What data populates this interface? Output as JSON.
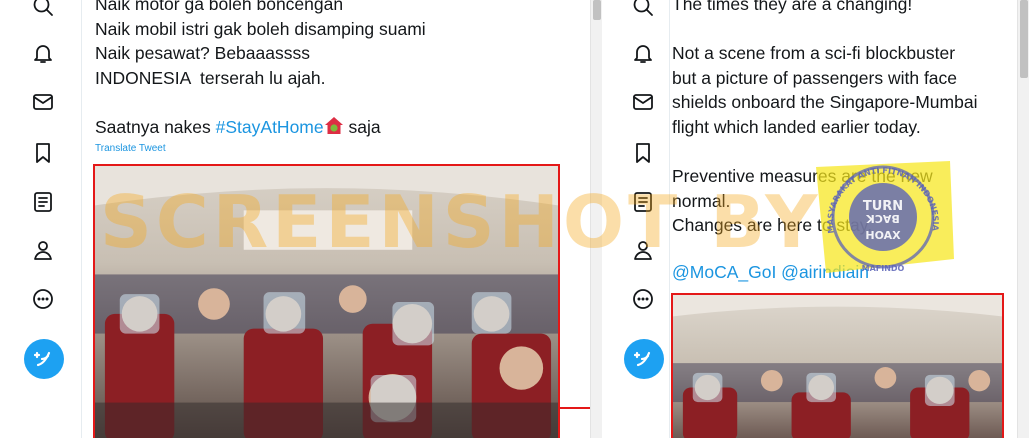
{
  "left_tweet": {
    "lines": [
      "Naik motor ga boleh boncengan",
      "Naik mobil istri gak boleh disamping suami",
      "Naik pesawat? Bebaaassss",
      "INDONESIA  terserah lu ajah.",
      "",
      "Saatnya nakes "
    ],
    "hashtag": "#StayAtHome",
    "after_hashtag": " saja",
    "translate_label": "Translate Tweet"
  },
  "right_tweet": {
    "lines": [
      "The times they are a changing!",
      "",
      "Not a scene from a sci-fi blockbuster",
      "but a picture of passengers with face",
      "shields onboard the Singapore-Mumbai",
      "flight which landed earlier today.",
      "",
      "Preventive measures are the new",
      "normal.",
      "Changes are here to stay."
    ],
    "mentions": "@MoCA_GoI @airindiain"
  },
  "overlay": {
    "watermark_text": "SCREENSHOT BY",
    "badge_top": "TURN",
    "badge_middle": "BACK",
    "badge_bottom": "HOAX",
    "badge_ring_left": "MASYARAKAT ANTI FITNAH INDONESIA",
    "badge_ring_bottom": "MAFINDO"
  },
  "colors": {
    "link": "#1b95e0",
    "compose": "#1da1f2",
    "highlight_box": "#e41818",
    "watermark": "#f4a81e",
    "badge_fill": "#f6e61c",
    "badge_circle": "#5b63b7"
  },
  "nav_icons": [
    "search-icon",
    "bell-icon",
    "mail-icon",
    "bookmark-icon",
    "list-icon",
    "profile-icon",
    "more-icon",
    "compose-icon"
  ]
}
